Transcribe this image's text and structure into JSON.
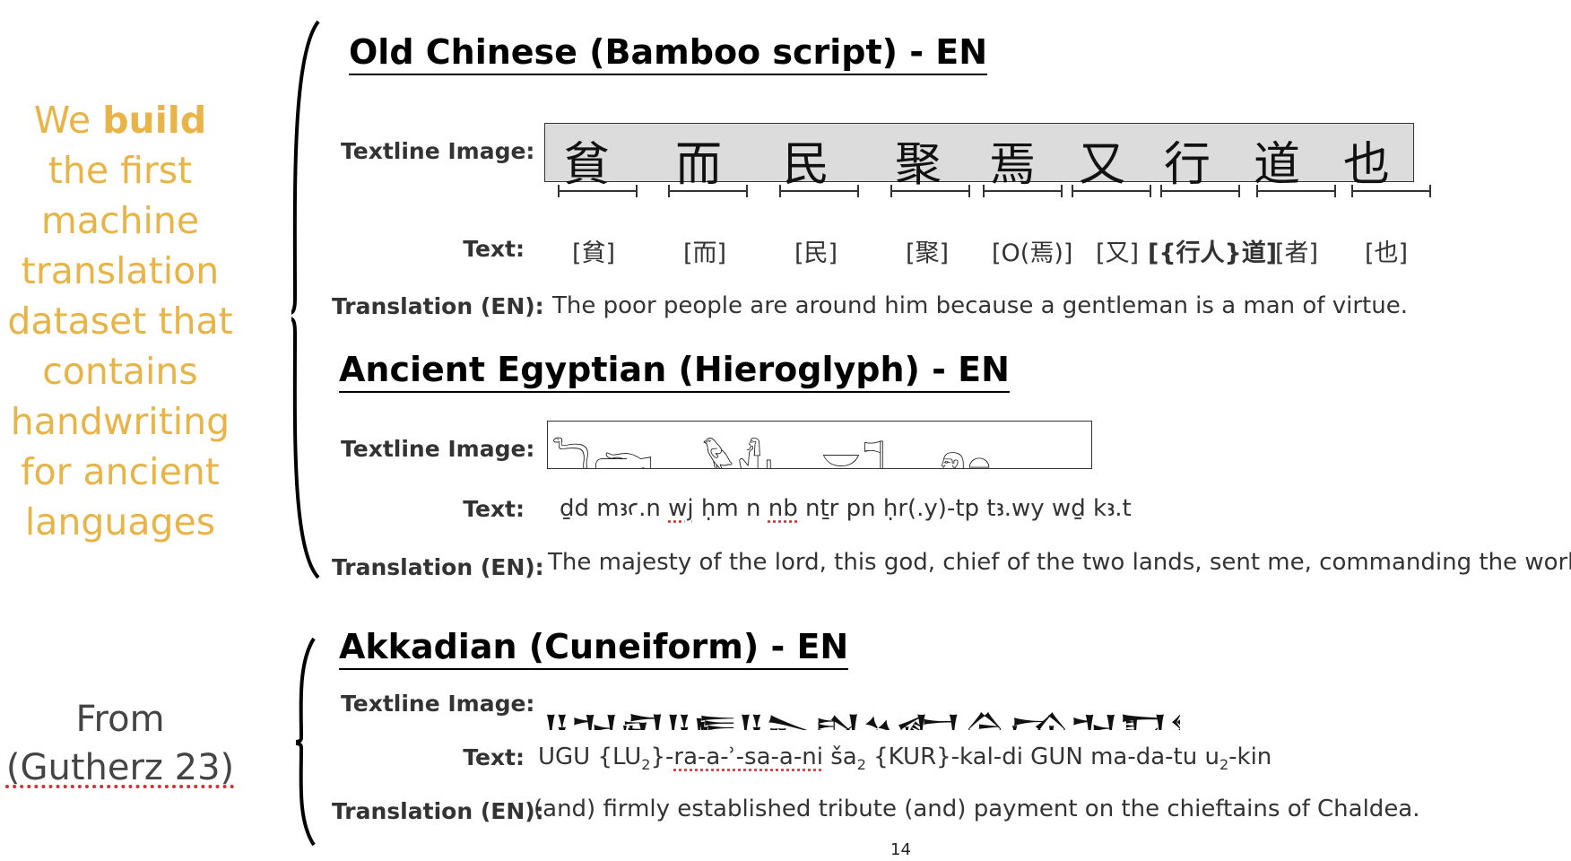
{
  "claim": {
    "pre": "We ",
    "bold": "build",
    "post": " the first machine translation dataset that contains handwriting for ancient languages"
  },
  "source": {
    "line1": "From",
    "cite": "(Gutherz 23)"
  },
  "labels": {
    "textline_image": "Textline Image:",
    "text": "Text:",
    "translation": "Translation (EN):"
  },
  "chinese": {
    "title": "Old Chinese (Bamboo script) - EN",
    "image_glyphs": [
      "貧",
      "而",
      "民",
      "聚",
      "焉",
      "又",
      "行",
      "道",
      "也"
    ],
    "tokens": [
      "[貧]",
      "[而]",
      "[民]",
      "[聚]",
      "[O(焉)]",
      "[又]",
      "[{行人}道]",
      "[者]",
      "[也]"
    ],
    "translation": "The poor people are around him because a gentleman is a man of virtue."
  },
  "egyptian": {
    "title": "Ancient Egyptian (Hieroglyph) - EN",
    "image_glyphs": "𓆓𓂧𓈖𓅱𓀭𓏤𓈖𓎟𓊹𓊃𓁶𓏏𓇾𓇾𓍿𓂋𓂓",
    "text": {
      "a": "ḏd mꜣꜥ.n ",
      "b": "wj",
      "c": " ḥm n ",
      "d": "nb",
      "e": " nṯr pn ḥr(.y)-tp tꜣ.wy wḏ kꜣ.t"
    },
    "translation": "The majesty of the lord, this god, chief of the two lands, sent me, commanding the work"
  },
  "akkadian": {
    "title": "Akkadian (Cuneiform) - EN",
    "image_glyphs": "𒀀𒈠𒊏𒀀𒊓𒀀𒉌𒊭𒆳𒅗𒁲𒄘𒈠𒁕𒌅𒆤",
    "text": {
      "a": "UGU {LU",
      "sub1": "2",
      "b": "}-",
      "c": "ra-a-ʾ-sa-a-ni",
      "d": " ša",
      "sub2": "2",
      "e": " {KUR}-kal-di GUN ma-da-tu u",
      "sub3": "2",
      "f": "-kin"
    },
    "translation": "(and) firmly established tribute (and) payment on the chieftains of Chaldea."
  },
  "page_number": "14"
}
